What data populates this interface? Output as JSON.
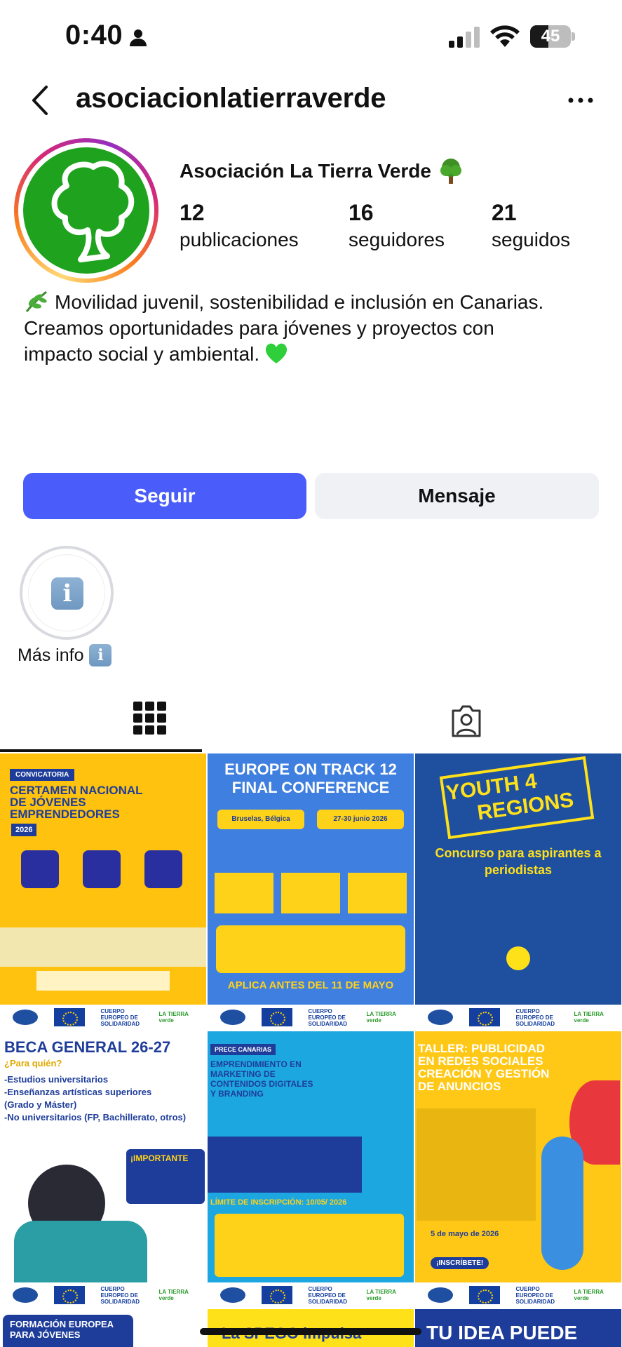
{
  "status": {
    "time": "0:40",
    "battery": "45"
  },
  "header": {
    "username": "asociacionlatierraverde"
  },
  "profile": {
    "name": "Asociación La Tierra Verde",
    "stats": [
      {
        "number": "12",
        "label": "publicaciones"
      },
      {
        "number": "16",
        "label": "seguidores"
      },
      {
        "number": "21",
        "label": "seguidos"
      }
    ],
    "bio": [
      "Movilidad juvenil, sostenibilidad e inclusión en Canarias.",
      "Creamos oportunidades para jóvenes y proyectos con",
      "impacto social y ambiental."
    ]
  },
  "actions": {
    "follow": "Seguir",
    "message": "Mensaje"
  },
  "highlight": {
    "label": "Más info",
    "icon": "i"
  },
  "posts": [
    {
      "lines": [
        "CONVICATORIA",
        "CERTAMEN NACIONAL",
        "DE JÓVENES",
        "EMPRENDEDORES",
        "2026"
      ]
    },
    {
      "lines": [
        "EUROPE ON TRACK 12",
        "FINAL CONFERENCE",
        "Bruselas, Bélgica",
        "27-30 junio 2026",
        "APLICA ANTES DEL 11 DE MAYO"
      ]
    },
    {
      "lines": [
        "YOUTH 4",
        "REGIONS",
        "Concurso para aspirantes a periodistas"
      ]
    },
    {
      "lines": [
        "BECA GENERAL 26-27",
        "¿Para quién?",
        "-Estudios universitarios",
        "-Enseñanzas artísticas superiores",
        "(Grado y Máster)",
        "-No universitarios (FP, Bachillerato, otros)",
        "¡IMPORTANTE"
      ]
    },
    {
      "lines": [
        "PRECE CANARIAS",
        "EMPRENDIMIENTO EN",
        "MARKETING DE",
        "CONTENIDOS DIGITALES",
        "Y BRANDING",
        "LÍMITE DE INSCRIPCIÓN: 10/05/ 2026"
      ]
    },
    {
      "lines": [
        "TALLER: PUBLICIDAD",
        "EN REDES SOCIALES",
        "CREACIÓN Y GESTIÓN",
        "DE ANUNCIOS",
        "5 de mayo de 2026",
        "¡INSCRÍBETE!"
      ]
    },
    {
      "lines": [
        "FORMACIÓN EUROPEA",
        "PARA JÓVENES"
      ]
    },
    {
      "lines": [
        "La SPEGO impulsa"
      ]
    },
    {
      "lines": [
        "TU IDEA PUEDE"
      ]
    }
  ],
  "colors": {
    "follow_button": "#4a5dfa",
    "message_button": "#eff1f5",
    "avatar_green": "#1fa31f"
  }
}
